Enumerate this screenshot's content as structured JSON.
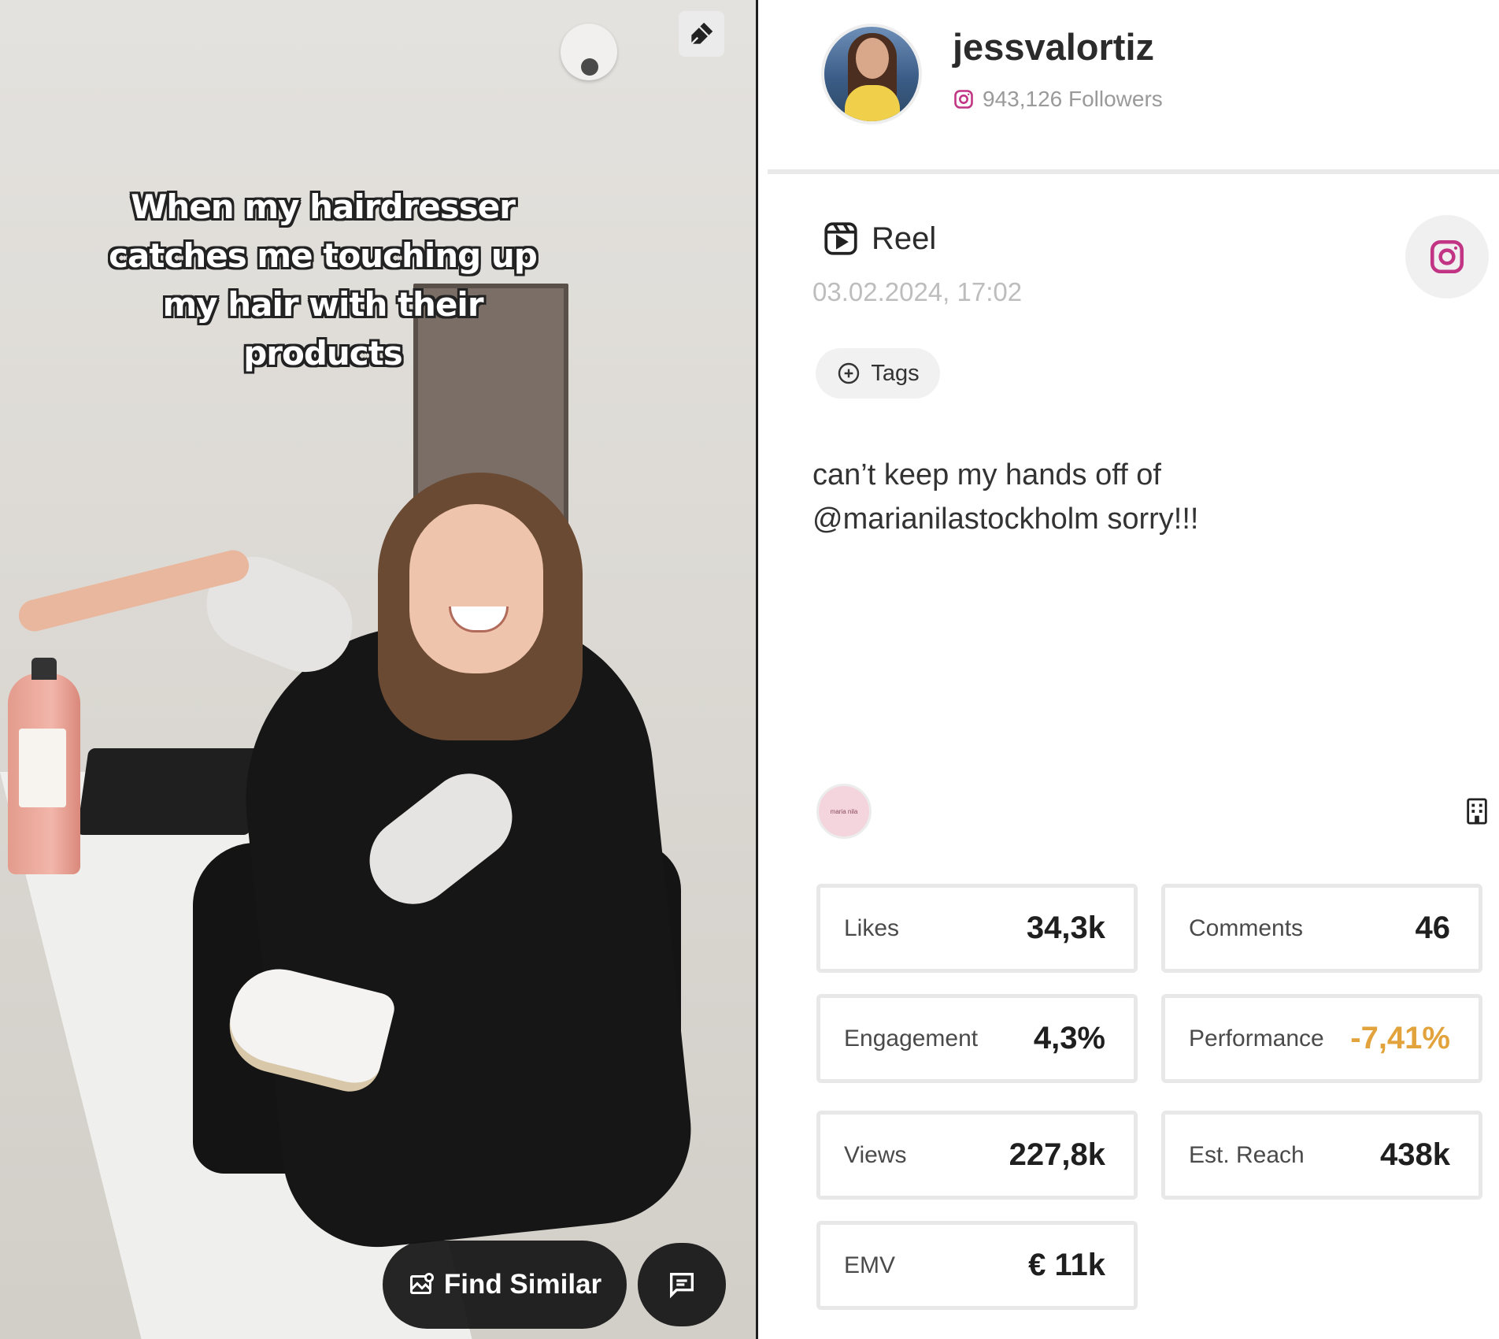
{
  "media": {
    "caption": "When my hairdresser catches me touching up my hair with their products",
    "find_similar_label": "Find Similar"
  },
  "profile": {
    "username": "jessvalortiz",
    "followers": "943,126 Followers",
    "platform": "instagram"
  },
  "post": {
    "type": "Reel",
    "date": "03.02.2024, 17:02",
    "tags_label": "Tags",
    "text": "can’t keep my hands off of @marianilastockholm sorry!!!",
    "brand_logo_text": "maria nila"
  },
  "stats": [
    {
      "label": "Likes",
      "value": "34,3k"
    },
    {
      "label": "Comments",
      "value": "46"
    },
    {
      "label": "Engagement",
      "value": "4,3%"
    },
    {
      "label": "Performance",
      "value": "-7,41%"
    },
    {
      "label": "Views",
      "value": "227,8k"
    },
    {
      "label": "Est. Reach",
      "value": "438k"
    },
    {
      "label": "EMV",
      "value": "€ 11k"
    }
  ],
  "colors": {
    "instagram": "#c13584",
    "negative": "#e2a33c",
    "card_border": "#e8e8e8"
  }
}
